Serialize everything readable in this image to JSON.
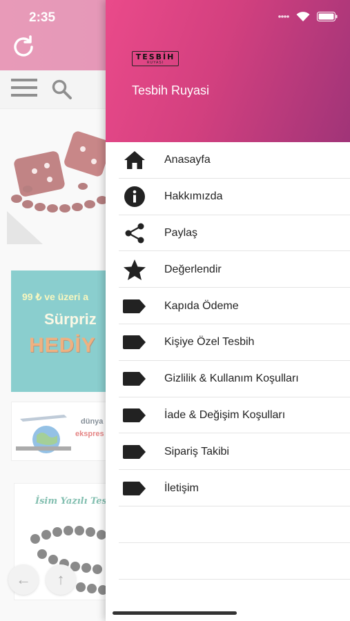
{
  "status_bar": {
    "time": "2:35"
  },
  "background": {
    "banner_line1": "99 ₺ ve üzeri a",
    "banner_line2": "Sürpriz",
    "banner_line3": "HEDİY",
    "strip_line1": "dünya",
    "strip_line2": "ekspres",
    "card_title": "İsim Yazılı Tesb"
  },
  "drawer": {
    "logo_text": "TESBİH",
    "logo_sub": "RUYASI",
    "title": "Tesbih Ruyasi",
    "header_gradient": [
      "#ea4a8a",
      "#a03478"
    ],
    "items": [
      {
        "label": "Anasayfa",
        "icon": "home-icon"
      },
      {
        "label": "Hakkımızda",
        "icon": "info-icon"
      },
      {
        "label": "Paylaş",
        "icon": "share-icon"
      },
      {
        "label": "Değerlendir",
        "icon": "star-icon"
      },
      {
        "label": "Kapıda Ödeme",
        "icon": "label-icon"
      },
      {
        "label": "Kişiye Özel Tesbih",
        "icon": "label-icon"
      },
      {
        "label": "Gizlilik & Kullanım Koşulları",
        "icon": "label-icon"
      },
      {
        "label": "İade & Değişim Koşulları",
        "icon": "label-icon"
      },
      {
        "label": "Sipariş Takibi",
        "icon": "label-icon"
      },
      {
        "label": "İletişim",
        "icon": "label-icon"
      }
    ]
  },
  "colors": {
    "accent": "#d5487f",
    "icon": "#222222"
  }
}
